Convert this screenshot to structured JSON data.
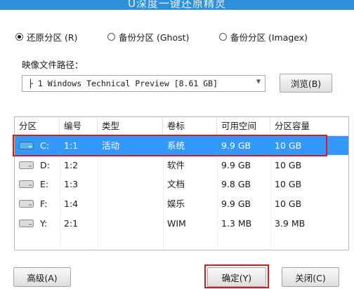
{
  "window": {
    "title": "U深度一键还原精灵"
  },
  "modes": [
    {
      "label": "还原分区 (R)",
      "checked": true
    },
    {
      "label": "备份分区 (Ghost)",
      "checked": false
    },
    {
      "label": "备份分区 (Imagex)",
      "checked": false
    }
  ],
  "image_path": {
    "label": "映像文件路径：",
    "value": "├ 1 Windows Technical Preview [8.61 GB]",
    "browse_label": "浏览(B)"
  },
  "table": {
    "headers": [
      "分区",
      "编号",
      "类型",
      "卷标",
      "可用空间",
      "分区容量"
    ],
    "rows": [
      {
        "partition": "C:",
        "number": "1:1",
        "type": "活动",
        "label": "系统",
        "free": "9.9 GB",
        "capacity": "10 GB",
        "selected": true
      },
      {
        "partition": "D:",
        "number": "1:2",
        "type": "",
        "label": "软件",
        "free": "9.9 GB",
        "capacity": "10 GB",
        "selected": false
      },
      {
        "partition": "E:",
        "number": "1:3",
        "type": "",
        "label": "文档",
        "free": "9.8 GB",
        "capacity": "10 GB",
        "selected": false
      },
      {
        "partition": "F:",
        "number": "1:4",
        "type": "",
        "label": "娱乐",
        "free": "9.9 GB",
        "capacity": "10 GB",
        "selected": false
      },
      {
        "partition": "Y:",
        "number": "2:1",
        "type": "",
        "label": "WIM",
        "free": "1.3 MB",
        "capacity": "3.9 MB",
        "selected": false
      }
    ]
  },
  "buttons": {
    "advanced": "高级(A)",
    "confirm": "确定(Y)",
    "close": "关闭(C)"
  },
  "colors": {
    "selection": "#3399ff",
    "annotation": "#e8141c",
    "titlebar": "#2f8fd8"
  }
}
